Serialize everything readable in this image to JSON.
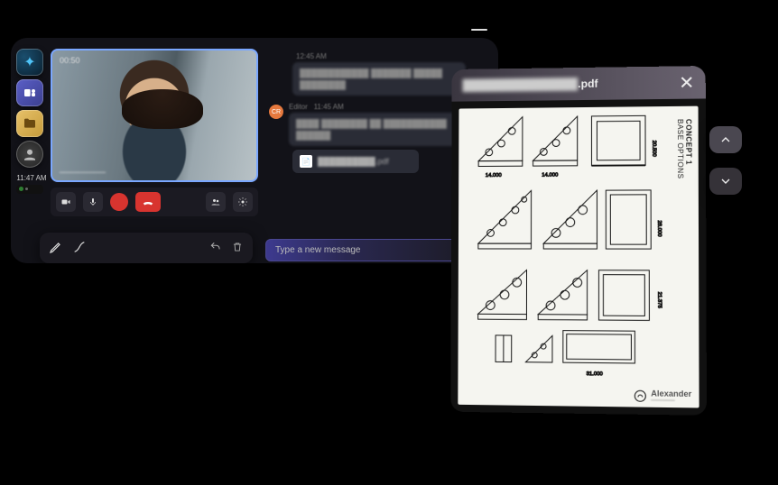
{
  "sidebar": {
    "apps": [
      {
        "name": "browser"
      },
      {
        "name": "teams"
      },
      {
        "name": "files"
      },
      {
        "name": "avatar"
      }
    ],
    "clock": {
      "time": "11:47 AM",
      "sub": "—"
    }
  },
  "call": {
    "timer": "00:50",
    "participant": "────────",
    "buttons": {
      "camera": "camera",
      "mic": "mic",
      "record": "rec",
      "hangup": "end",
      "people": "people",
      "more": "settings"
    }
  },
  "pen": {
    "tools": [
      "pen",
      "eraser"
    ],
    "undo": "undo",
    "delete": "delete"
  },
  "chat": {
    "messages": [
      {
        "meta": "12:45 AM",
        "body": "████████████ ███████ █████ ████████"
      },
      {
        "avatar": "CR",
        "author": "Editor",
        "time": "11:45 AM",
        "body": "████ ████████ ██ ███████████ ██████"
      }
    ],
    "attachment": {
      "name": "██████████.pdf"
    },
    "compose_placeholder": "Type a new message"
  },
  "pdf": {
    "title_masked": "███████████████",
    "title_ext": ".pdf",
    "side_label_1": "CONCEPT 1",
    "side_label_2": "BASE OPTIONS",
    "footer_brand": "Alexander",
    "footer_sub": "──────",
    "dims": [
      "14.000",
      "14.000",
      "20.500",
      "28.000",
      "21.375",
      "31.000"
    ]
  }
}
